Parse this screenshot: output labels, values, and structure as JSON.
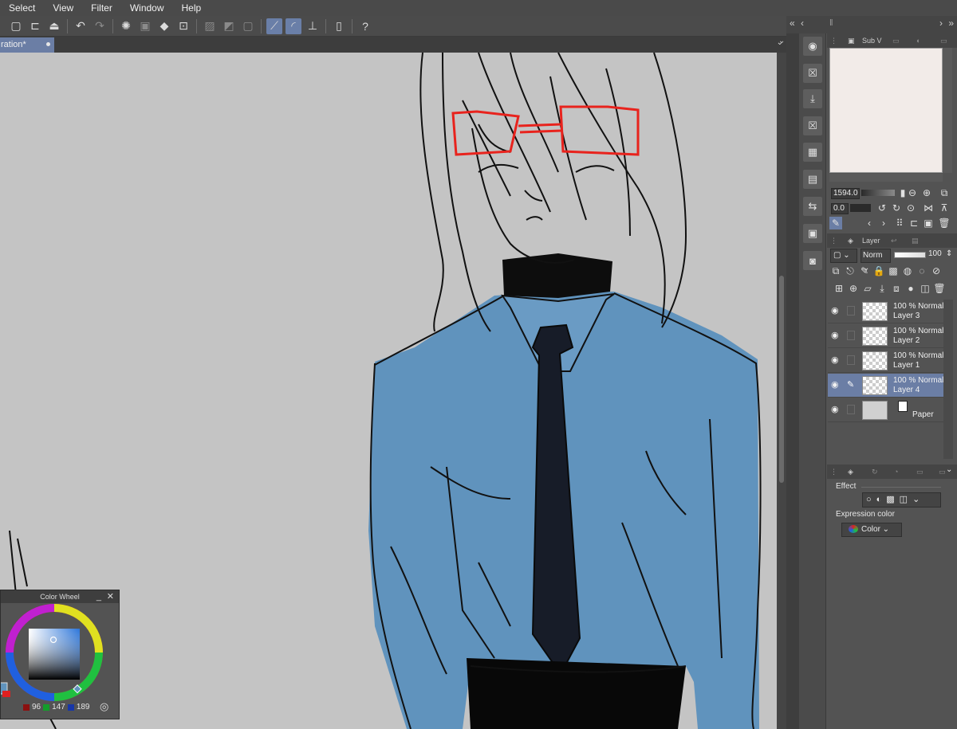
{
  "menu": [
    "Select",
    "View",
    "Filter",
    "Window",
    "Help"
  ],
  "command_icons": [
    "new-icon",
    "open-icon",
    "save-icon",
    "undo-icon",
    "redo-icon",
    "clear-icon",
    "fill-icon",
    "transform-icon",
    "selection-icon",
    "ruler-icon",
    "snap-icon",
    "device-icon",
    "help-icon"
  ],
  "tab": {
    "label": "ration*"
  },
  "color_wheel": {
    "title": "Color Wheel",
    "minimize": "_",
    "close": "✕",
    "r": "96",
    "g": "147",
    "b": "189",
    "current_color": "#6093bd"
  },
  "navigator": {
    "tab_label": "Sub V",
    "zoom": "1594.0",
    "angle": "0.0"
  },
  "layer_panel": {
    "tab_label": "Layer",
    "blend_mode": "Norm",
    "opacity": "100",
    "layers": [
      {
        "line1": "100 % Normal",
        "line2": "Layer 3",
        "selected": false
      },
      {
        "line1": "100 % Normal",
        "line2": "Layer 2",
        "selected": false
      },
      {
        "line1": "100 % Normal",
        "line2": "Layer 1",
        "selected": false
      },
      {
        "line1": "100 % Normal",
        "line2": "Layer 4",
        "selected": true
      }
    ],
    "paper_label": "Paper"
  },
  "properties": {
    "effect_label": "Effect",
    "expression_label": "Expression color",
    "expression_value": "Color"
  },
  "colors": {
    "shirt": "#6093bd",
    "tie": "#171c28",
    "glasses": "#e8231d",
    "canvas_bg": "#c4c4c4",
    "selection": "#6b7ea5"
  }
}
